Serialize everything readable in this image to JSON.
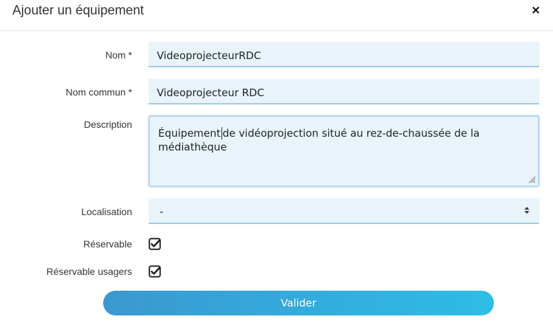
{
  "dialog": {
    "title": "Ajouter un équipement",
    "close_label": "×"
  },
  "form": {
    "nom_label": "Nom *",
    "nom_value": "VideoprojecteurRDC",
    "nom_commun_label": "Nom commun *",
    "nom_commun_value": "Videoprojecteur RDC",
    "description_label": "Description",
    "description_before_caret": "Équipement",
    "description_after_caret": "de vidéoprojection situé au rez-de-chaussée de la médiathèque",
    "localisation_label": "Localisation",
    "localisation_value": "-",
    "reservable_label": "Réservable",
    "reservable_checked": true,
    "reservable_usagers_label": "Réservable usagers",
    "reservable_usagers_checked": true,
    "submit_label": "Valider"
  },
  "colors": {
    "field_bg": "#e8f4fa",
    "button_gradient_start": "#3a98d0",
    "button_gradient_end": "#2dbde6"
  }
}
